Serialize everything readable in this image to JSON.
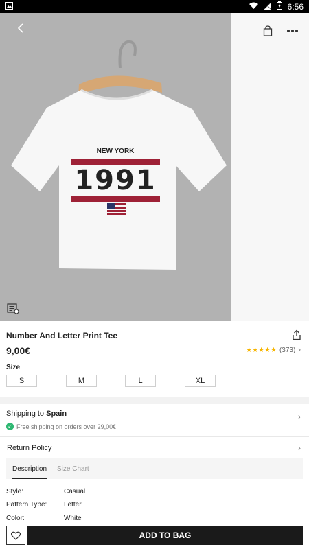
{
  "status_bar": {
    "time": "6:56",
    "icons": [
      "image-icon",
      "wifi-icon",
      "signal-icon",
      "battery-icon"
    ]
  },
  "header": {
    "back_icon": "chevron-left-icon",
    "bag_icon": "shopping-bag-icon",
    "more_icon": "more-horizontal-icon"
  },
  "product": {
    "image_text": {
      "line1": "NEW YORK",
      "line2": "1991"
    },
    "title": "Number And Letter Print Tee",
    "price": "9,00€",
    "rating_count": "(373)",
    "rating_stars": 4.5,
    "size_label": "Size",
    "sizes": [
      "S",
      "M",
      "L",
      "XL"
    ]
  },
  "shipping": {
    "prefix": "Shipping to ",
    "country": "Spain",
    "free_note": "Free shipping on orders over 29,00€"
  },
  "return_policy": "Return Policy",
  "tabs": [
    {
      "label": "Description",
      "active": true
    },
    {
      "label": "Size Chart",
      "active": false
    }
  ],
  "specs": [
    {
      "label": "Style:",
      "value": "Casual"
    },
    {
      "label": "Pattern Type:",
      "value": "Letter"
    },
    {
      "label": "Color:",
      "value": "White"
    }
  ],
  "bottom": {
    "add_to_bag": "ADD TO BAG"
  },
  "colors": {
    "accent": "#1a1a1a",
    "star": "#f7b500",
    "check": "#2eb872",
    "print_red": "#9e2136"
  }
}
